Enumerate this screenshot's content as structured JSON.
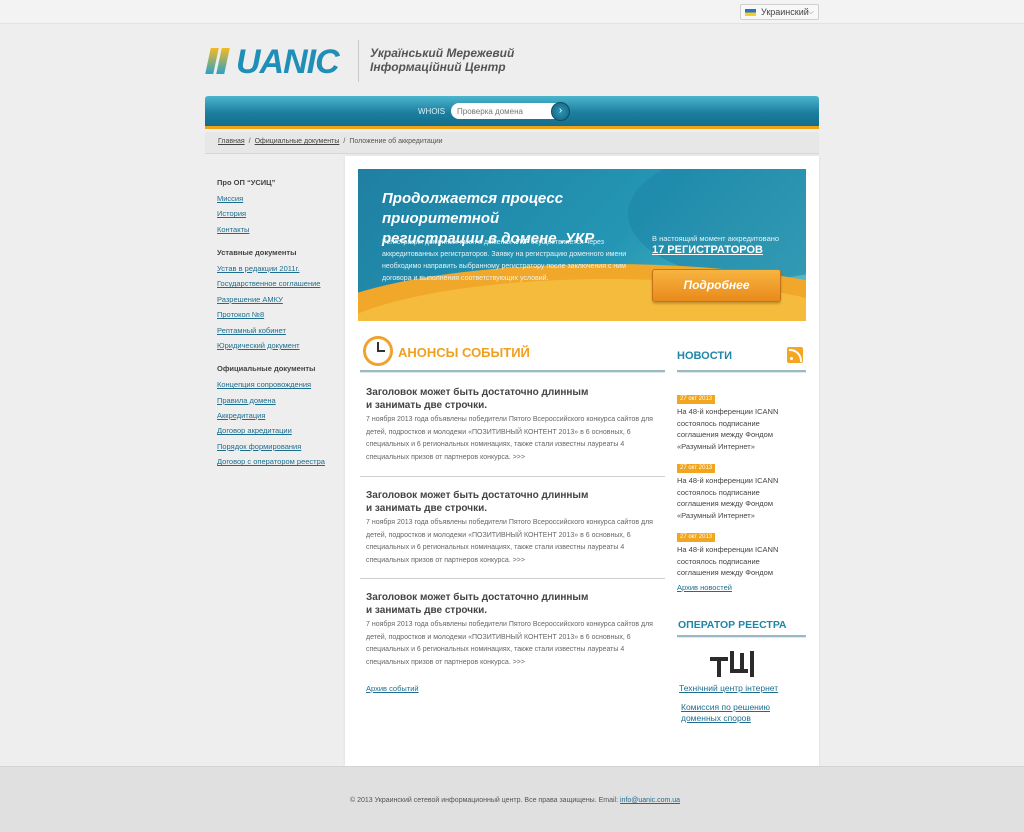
{
  "language": {
    "selected": "Украинский"
  },
  "logo": {
    "brand": "UANIC",
    "subtitle_line1": "Український Мережевий",
    "subtitle_line2": "Інформаційний Центр"
  },
  "whois": {
    "label": "WHOIS",
    "placeholder": "Проверка домена",
    "go_icon": "arrow-right-icon"
  },
  "breadcrumb": {
    "home": "Главная",
    "docs": "Официальные документы",
    "current": "Положение об аккредитации",
    "separator": "/"
  },
  "sidebar": {
    "groups": [
      {
        "title": "Про ОП “УСИЦ”",
        "items": [
          "Миссия",
          "История",
          "Контакты"
        ]
      },
      {
        "title": "Уставные документы",
        "items": [
          "Устав в редакции 2011г.",
          "Государственное соглашение",
          "Разрешение АМКУ",
          "Протокол №8",
          "Рептамный кобинет",
          "Юридический документ"
        ]
      },
      {
        "title": "Официальные документы",
        "items": [
          "Концепция сопровождения",
          "Правила домена",
          "Аккредитация",
          "Договор акредитации",
          "Порядок формирования",
          "Договор с оператором реестра"
        ]
      }
    ]
  },
  "banner": {
    "title_line1": "Продолжается процесс приоритетной",
    "title_line2": "регистрации в домене .УКР",
    "desc_pre": "Регистрация доменных имен в доменах ",
    "desc_bold": ".УКР",
    "desc_post": " осуществляется через аккредитованных регистраторов. Заявку на регистрацию доменного имени необходимо направить выбранному регистратору после заключения с ним договора и выполнения соответствующих условий.",
    "now_text": "В настоящий момент аккредитовано",
    "count_text": "17 РЕГИСТРАТОРОВ",
    "more_button": "Подробнее"
  },
  "events": {
    "title": "АНОНСЫ СОБЫТИЙ",
    "items": [
      {
        "title_line1": "Заголовок может быть достаточно длинным",
        "title_line2": "и занимать две строчки.",
        "text": "7 ноября 2013 года объявлены победители Пятого Всероссийского конкурса сайтов для детей, подростков и молодежи «ПОЗИТИВНЫЙ КОНТЕНТ 2013» в 6 основных, 6 специальных и 6 региональных номинациях, также стали известны лауреаты 4 специальных призов от партнеров конкурса. >>>"
      },
      {
        "title_line1": "Заголовок может быть достаточно длинным",
        "title_line2": "и занимать две строчки.",
        "text": "7 ноября 2013 года объявлены победители Пятого Всероссийского конкурса сайтов для детей, подростков и молодежи «ПОЗИТИВНЫЙ КОНТЕНТ 2013» в 6 основных, 6 специальных и 6 региональных номинациях, также стали известны лауреаты 4 специальных призов от партнеров конкурса. >>>"
      },
      {
        "title_line1": "Заголовок может быть достаточно длинным",
        "title_line2": "и занимать две строчки.",
        "text": "7 ноября 2013 года объявлены победители Пятого Всероссийского конкурса сайтов для детей, подростков и молодежи «ПОЗИТИВНЫЙ КОНТЕНТ 2013» в 6 основных, 6 специальных и 6 региональных номинациях, также стали известны лауреаты 4 специальных призов от партнеров конкурса. >>>"
      }
    ],
    "archive": "Архив событий"
  },
  "news": {
    "title": "НОВОСТИ",
    "rss_icon": "rss-icon",
    "items": [
      {
        "date": "27 окт 2013",
        "text": "На 48-й конференции ICANN состоялось подписание соглашения между Фондом «Разумный Интернет»"
      },
      {
        "date": "27 окт 2013",
        "text": "На 48-й конференции ICANN состоялось подписание соглашения между Фондом «Разумный Интернет»"
      },
      {
        "date": "27 окт 2013",
        "text": "На 48-й конференции ICANN состоялось подписание соглашения между Фондом"
      }
    ],
    "archive": "Архив новостей"
  },
  "registry": {
    "title": "ОПЕРАТОР РЕЕСТРА",
    "logo_icon": "tci-logo-icon",
    "link1": "Технічний центр інтернет",
    "link2_line1": "Комиссия по решению",
    "link2_line2": "доменных споров"
  },
  "footer": {
    "text": "© 2013 Украинский сетевой информационный центр. Все права защищены. Email: ",
    "email": "info@uanic.com.ua"
  }
}
